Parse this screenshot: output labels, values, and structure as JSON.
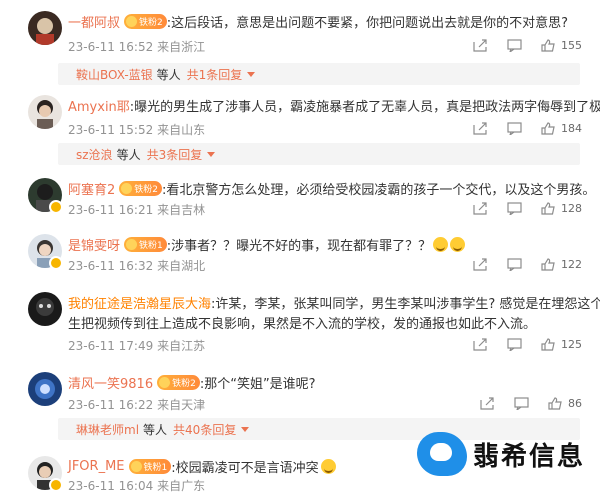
{
  "comments": [
    {
      "user": "一都阿叔",
      "fan_label": "铁粉2",
      "text": ":这后段话，意思是出问题不要紧，你把问题说出去就是你的不对意思?",
      "text2": "",
      "time": "23-6-11 16:52",
      "location": "来自浙江",
      "likes": "155",
      "reply": {
        "user": "鞍山BOX-蓝银",
        "mid": "等人",
        "total": "共1条回复"
      }
    },
    {
      "user": "Amyxin耶",
      "fan_label": "",
      "text": ":曝光的男生成了涉事人员，霸凌施暴者成了无辜人员，真是把政法两字侮辱到了极致",
      "text2": "",
      "time": "23-6-11 15:52",
      "location": "来自山东",
      "likes": "184",
      "reply": {
        "user": "sz沧浪",
        "mid": "等人",
        "total": "共3条回复"
      }
    },
    {
      "user": "阿塞育2",
      "fan_label": "铁粉2",
      "text": ":看北京警方怎么处理，必须给受校园凌霸的孩子一个交代，以及这个男孩。",
      "text2": "",
      "time": "23-6-11 16:21",
      "location": "来自吉林",
      "likes": "128"
    },
    {
      "user": "是锦雯呀",
      "fan_label": "铁粉1",
      "text": ":涉事者？？曝光不好的事，现在都有罪了？？",
      "text2": "",
      "time": "23-6-11 16:32",
      "location": "来自湖北",
      "likes": "122"
    },
    {
      "user": "我的征途是浩瀚星辰大海",
      "fan_label": "",
      "text": ":许某，李某，张某叫同学，男生李某叫涉事学生? 感觉是在埋怨这个男",
      "text2": "生把视频传到往上造成不良影响，果然是不入流的学校，发的通报也如此不入流。",
      "time": "23-6-11 17:49",
      "location": "来自江苏",
      "likes": "125"
    },
    {
      "user": "清风一笑9816",
      "fan_label": "铁粉2",
      "text": ":那个“笑姐”是谁呢?",
      "text2": "",
      "time": "23-6-11 16:22",
      "location": "来自天津",
      "likes": "86",
      "reply": {
        "user": "琳琳老师ml",
        "mid": "等人",
        "total": "共40条回复"
      }
    },
    {
      "user": "JFOR_ME",
      "fan_label": "铁粉1",
      "text": ":校园霸凌可不是言语冲突",
      "text2": "",
      "time": "23-6-11 16:04",
      "location": "来自广东",
      "likes": ""
    }
  ],
  "watermark": {
    "text": "翡希信息"
  },
  "colors": {
    "username": "#eb7350",
    "meta": "#939393",
    "reply_bg": "#f4f4f4",
    "logo_blue": "#1f8fe8"
  },
  "icons": [
    "share-icon",
    "comment-icon",
    "like-icon",
    "vip-badge-icon",
    "fan-badge-heart-icon"
  ]
}
